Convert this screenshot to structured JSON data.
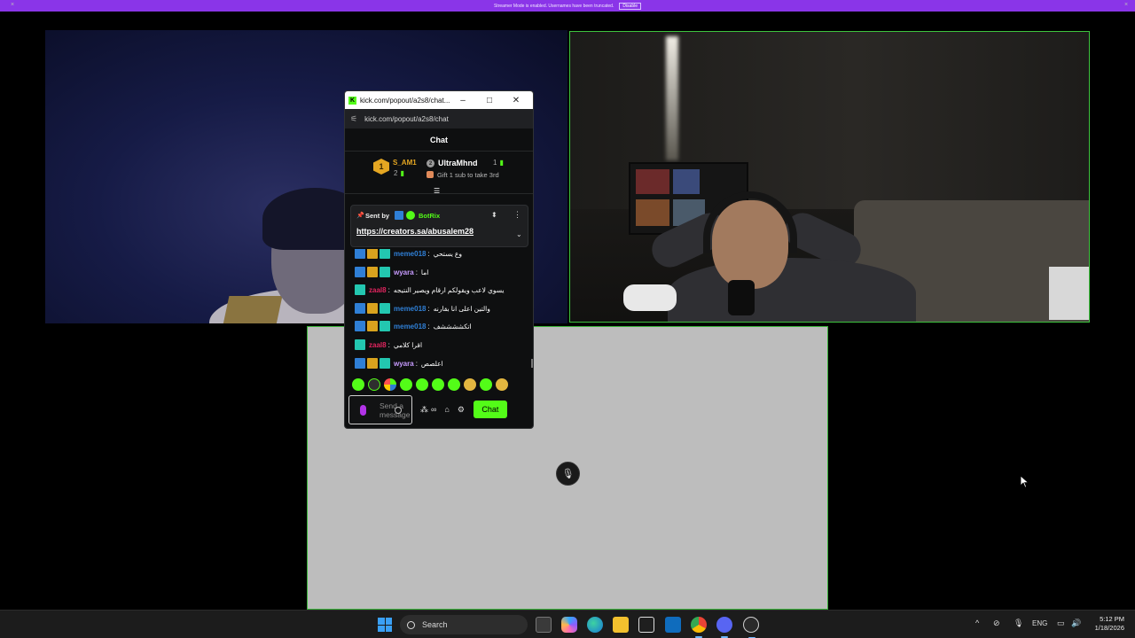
{
  "banner": {
    "text": "Streamer Mode is enabled. Usernames have been truncated.",
    "button": "Disable"
  },
  "window": {
    "title": "kick.com/popout/a2s8/chat...",
    "url": "kick.com/popout/a2s8/chat",
    "minimize": "–",
    "maximize": "□",
    "close": "✕"
  },
  "chat": {
    "header": "Chat",
    "leaderboard": {
      "first": {
        "rank": "1",
        "name": "S_AM1",
        "count": "2"
      },
      "second": {
        "name": "UltraMhnd",
        "count": "1"
      },
      "hint": "Gift 1 sub to take 3rd"
    },
    "pinned": {
      "sent_by_label": "Sent by",
      "sender": "BotRix",
      "link": "https://creators.sa/abusalem28"
    },
    "messages": [
      {
        "user": "meme018",
        "color": "#2f7fd6",
        "badges": [
          "blue",
          "gold",
          "teal"
        ],
        "text": "وع يستحي"
      },
      {
        "user": "wyara",
        "color": "#c79bff",
        "badges": [
          "blue",
          "gold",
          "teal"
        ],
        "text": "اما"
      },
      {
        "user": "zaal8",
        "color": "#e0245e",
        "badges": [
          "teal"
        ],
        "text": "يسوي لاعب ويقولكم ارقام ويصير النتيجه"
      },
      {
        "user": "meme018",
        "color": "#2f7fd6",
        "badges": [
          "blue",
          "gold",
          "teal"
        ],
        "text": "والتين اعلى انا بقارنه"
      },
      {
        "user": "meme018",
        "color": "#2f7fd6",
        "badges": [
          "blue",
          "gold",
          "teal"
        ],
        "text": "اتكششششف"
      },
      {
        "user": "zaal8",
        "color": "#e0245e",
        "badges": [
          "teal"
        ],
        "text": "اقرا كلامي"
      },
      {
        "user": "wyara",
        "color": "#c79bff",
        "badges": [
          "blue",
          "gold",
          "teal"
        ],
        "text": "اعلصص"
      }
    ],
    "input_placeholder": "Send a message",
    "send_button": "Chat",
    "accent": "#53fc18"
  },
  "taskbar": {
    "search_label": "Search",
    "lang": "ENG",
    "time": "5:12 PM",
    "date": "1/18/2026"
  }
}
